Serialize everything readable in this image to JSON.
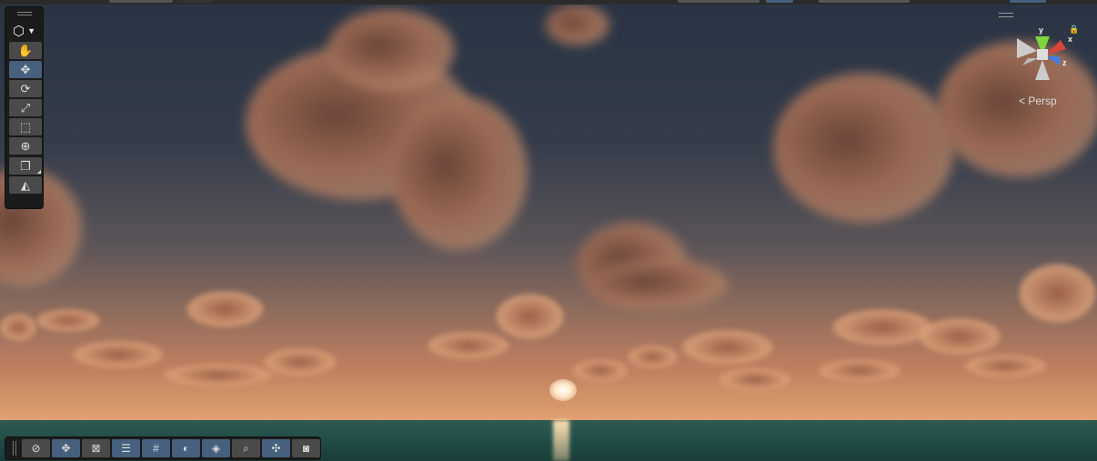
{
  "scene_view": {
    "camera_mode": "Persp",
    "gizmo_axes": {
      "y": "y",
      "x": "x",
      "z": "z"
    },
    "colors": {
      "active_tool": "#46607e",
      "tool_bg": "#4a4a4a",
      "axis_y": "#7cd63c",
      "axis_x": "#d9453a",
      "axis_z": "#3f7fe8"
    }
  },
  "tools_overlay": {
    "view_selector_icon": "cube-icon",
    "tools": [
      {
        "name": "view-tool",
        "icon": "✋",
        "active": false
      },
      {
        "name": "move-tool",
        "icon": "✥",
        "active": true
      },
      {
        "name": "rotate-tool",
        "icon": "⟳",
        "active": false
      },
      {
        "name": "scale-tool",
        "icon": "⤢",
        "active": false
      },
      {
        "name": "rect-tool",
        "icon": "⬚",
        "active": false
      },
      {
        "name": "transform-tool",
        "icon": "⊕",
        "active": false
      },
      {
        "name": "custom-tools",
        "icon": "❐",
        "active": false
      },
      {
        "name": "custom-editor-tool",
        "icon": "◭",
        "active": false
      }
    ]
  },
  "bottom_toolbar": {
    "buttons": [
      {
        "name": "orientation",
        "icon": "⊘",
        "active": false
      },
      {
        "name": "move-handle",
        "icon": "✥",
        "active": true
      },
      {
        "name": "transform-tools",
        "icon": "⊠",
        "active": false
      },
      {
        "name": "settings",
        "icon": "☰",
        "active": true
      },
      {
        "name": "grid",
        "icon": "#",
        "active": true
      },
      {
        "name": "shading",
        "icon": "◐",
        "active": true
      },
      {
        "name": "layers",
        "icon": "◈",
        "active": true
      },
      {
        "name": "search",
        "icon": "⌕",
        "active": false
      },
      {
        "name": "navigation",
        "icon": "✣",
        "active": true
      },
      {
        "name": "camera-visibility",
        "icon": "◙",
        "active": false
      }
    ]
  }
}
